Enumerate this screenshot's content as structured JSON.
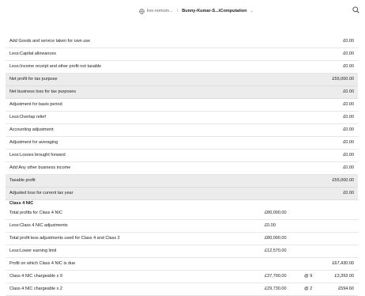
{
  "header": {
    "site": "live.nomom...",
    "separator": "/",
    "file_name": "Bunny-Kumar-S...tComputation",
    "chevron": "⌄",
    "globe_icon": "globe-icon",
    "search_icon": "search-icon"
  },
  "rows": [
    {
      "label": "Add Goods and service taken for own use",
      "amount": "£0.00"
    },
    {
      "label": "Less:Capital allowances",
      "amount": "£0.00"
    },
    {
      "label": "Less:Income receipt and other profit not taxable",
      "amount": "£0.00"
    },
    {
      "label": "Net profit for tax purpose",
      "amount": "£55,000.00"
    },
    {
      "label": "Net business loss for tax purposes",
      "amount": "£0.00"
    },
    {
      "label": "Adjustment for basis period",
      "amount": "£0.00"
    },
    {
      "label": "Less:Overlap relief",
      "amount": "£0.00"
    },
    {
      "label": "Accounting adjustment",
      "amount": "£0.00"
    },
    {
      "label": "Adjustment for averaging",
      "amount": "£0.00"
    },
    {
      "label": "Less:Losses brought forward",
      "amount": "£0.00"
    },
    {
      "label": "Add:Any other business income",
      "amount": "£0.00"
    },
    {
      "label": "Taxable profit",
      "amount": "£55,000.00"
    },
    {
      "label": "Adjusted loss for current tax year",
      "amount": "£0.00"
    },
    {
      "label": "Class 4 NIC"
    },
    {
      "label": "Total profits for Class 4 NIC",
      "col1": "£80,000.00"
    },
    {
      "label": "Less:Class 4 NIC adjustments",
      "col1": "£0.00"
    },
    {
      "label": "Total profit less adjustments used for Class 4 and Class 2",
      "col1": "£80,000.00"
    },
    {
      "label": "Less:Lower earning limit",
      "col1": "£12,570.00"
    },
    {
      "label": "Profit on which Class 4 NIC is due",
      "amount": "£67,430.00"
    },
    {
      "label": "Class 4 NIC chargeable x 9",
      "col1": "£37,700.00",
      "rate": "@ 9",
      "amount": "£3,393.00"
    },
    {
      "label": "Class 4 NIC chargeable x 2",
      "col1": "£29,730.00",
      "rate": "@ 2",
      "amount": "£594.60"
    }
  ]
}
